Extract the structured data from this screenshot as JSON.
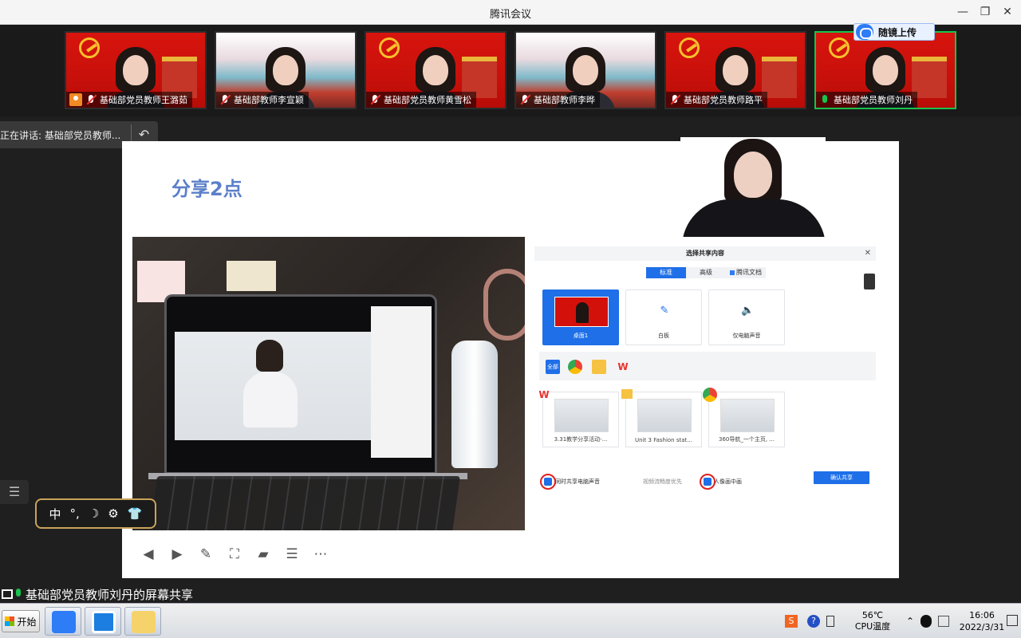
{
  "window": {
    "title": "腾讯会议"
  },
  "participants": [
    {
      "name": "基础部党员教师王潞茹",
      "bg": "red",
      "host": true,
      "mic": "off"
    },
    {
      "name": "基础部教师李宣颖",
      "bg": "photo",
      "mic": "off"
    },
    {
      "name": "基础部党员教师黄雪松",
      "bg": "red",
      "mic": "off"
    },
    {
      "name": "基础部教师李晔",
      "bg": "photo",
      "mic": "off"
    },
    {
      "name": "基础部党员教师路平",
      "bg": "red",
      "mic": "off"
    },
    {
      "name": "基础部党员教师刘丹",
      "bg": "red",
      "mic": "on",
      "active": true
    }
  ],
  "cloud_upload": {
    "label": "随镜上传"
  },
  "speaking": {
    "text": "正在讲话: 基础部党员教师..."
  },
  "slide": {
    "title": "分享2点",
    "dialog": {
      "title": "选择共享内容",
      "tabs": [
        "标准",
        "高级",
        "腾讯文档"
      ],
      "options": [
        "桌面1",
        "白板",
        "仅电脑声音"
      ],
      "filter_all": "全部",
      "windows": [
        "3.31教学分享活动-...",
        "Unit 3 Fashion stat...",
        "360导航_一个主页, ..."
      ],
      "checks": [
        "同时共享电脑声音",
        "视频流畅度优先",
        "人像画中画"
      ],
      "confirm": "确认共享"
    }
  },
  "share_status": "基础部党员教师刘丹的屏幕共享",
  "ime": {
    "items": [
      "中",
      "°,",
      "☽",
      "⚙",
      "👕"
    ]
  },
  "taskbar": {
    "start": "开始",
    "cpu_temp": "56℃",
    "cpu_label": "CPU温度",
    "time": "16:06",
    "date": "2022/3/31"
  },
  "colors": {
    "accent": "#1e6fe8",
    "active_border": "#19c24b",
    "slide_title": "#5b7fc9"
  }
}
